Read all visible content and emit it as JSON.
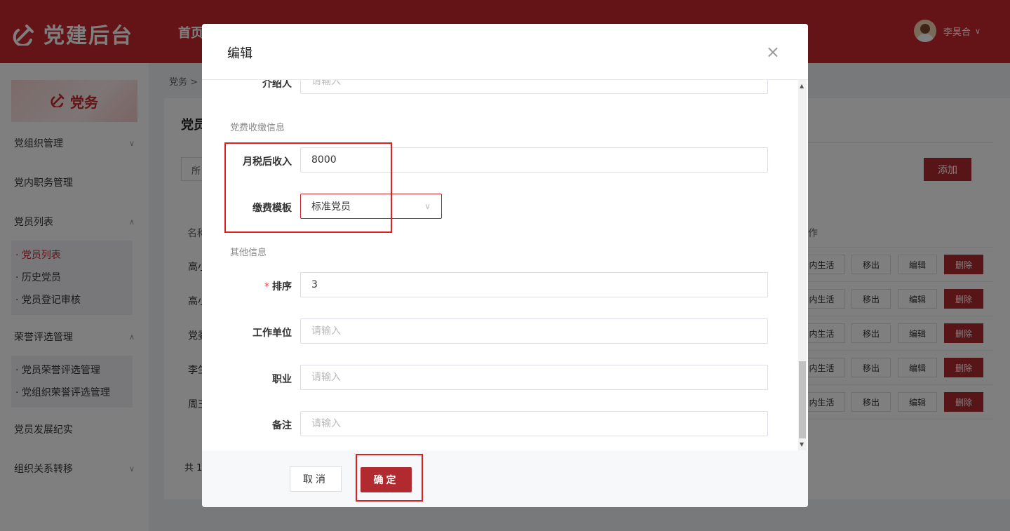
{
  "header": {
    "logo_text": "党建后台",
    "nav_first": "首页",
    "user_name": "李昊合"
  },
  "sidebar": {
    "banner": "党务",
    "groups": [
      {
        "label": "党组织管理"
      },
      {
        "label": "党内职务管理"
      },
      {
        "label": "党员列表"
      },
      {
        "label": "荣誉评选管理"
      },
      {
        "label": "党员发展纪实"
      },
      {
        "label": "组织关系转移"
      }
    ],
    "member_sub": [
      "· 党员列表",
      "· 历史党员",
      "· 党员登记审核"
    ],
    "honor_sub": [
      "· 党员荣誉评选管理",
      "· 党组织荣誉评选管理"
    ]
  },
  "page": {
    "breadcrumb": "党务 >",
    "title": "党员",
    "filter": "所",
    "add_button": "添加",
    "col_name": "名称",
    "col_ops": "作",
    "rows": [
      {
        "name": "高小"
      },
      {
        "name": "高小"
      },
      {
        "name": "党委"
      },
      {
        "name": "李生"
      },
      {
        "name": "周王"
      }
    ],
    "actions": {
      "life": "内生活",
      "move": "移出",
      "edit": "编辑",
      "delete": "删除"
    },
    "total": "共 1"
  },
  "modal": {
    "title": "编辑",
    "close_glyph": "×",
    "fields": {
      "introducer_label": "介绍人",
      "introducer_placeholder": "请输入",
      "fee_section": "党费收缴信息",
      "income_label": "月税后收入",
      "income_value": "8000",
      "template_label": "缴费模板",
      "template_value": "标准党员",
      "other_section": "其他信息",
      "sort_label": "排序",
      "sort_value": "3",
      "workplace_label": "工作单位",
      "workplace_placeholder": "请输入",
      "job_label": "职业",
      "job_placeholder": "请输入",
      "remark_label": "备注",
      "remark_placeholder": "请输入"
    },
    "cancel_label": "取消",
    "ok_label": "确定"
  },
  "colors": {
    "brand": "#c8282e",
    "danger_button": "#b02a2f",
    "highlight": "#e02020"
  }
}
